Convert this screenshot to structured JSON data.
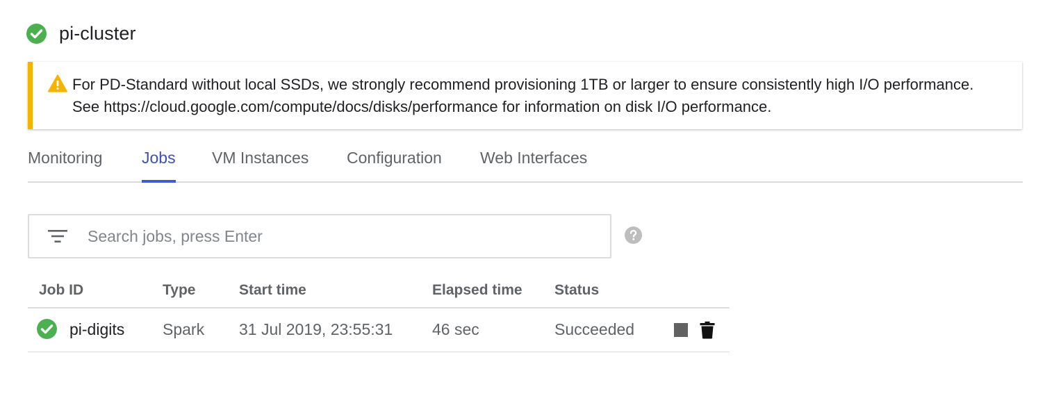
{
  "cluster": {
    "name": "pi-cluster",
    "status_icon": "check-circle-icon",
    "status_color": "#4caf50"
  },
  "banner": {
    "icon": "warning-icon",
    "accent_color": "#f4b400",
    "text": "For PD-Standard without local SSDs, we strongly recommend provisioning 1TB or larger to ensure consistently high I/O performance. See https://cloud.google.com/compute/docs/disks/performance for information on disk I/O performance."
  },
  "tabs": [
    {
      "label": "Monitoring",
      "active": false
    },
    {
      "label": "Jobs",
      "active": true
    },
    {
      "label": "VM Instances",
      "active": false
    },
    {
      "label": "Configuration",
      "active": false
    },
    {
      "label": "Web Interfaces",
      "active": false
    }
  ],
  "search": {
    "icon": "filter-icon",
    "placeholder": "Search jobs, press Enter",
    "value": "",
    "help_icon": "help-icon"
  },
  "table": {
    "columns": [
      "Job ID",
      "Type",
      "Start time",
      "Elapsed time",
      "Status"
    ],
    "rows": [
      {
        "status_icon": "check-circle-icon",
        "job_id": "pi-digits",
        "type": "Spark",
        "start_time": "31 Jul 2019, 23:55:31",
        "elapsed": "46 sec",
        "status": "Succeeded",
        "actions": [
          "stop-icon",
          "delete-icon"
        ]
      }
    ]
  },
  "colors": {
    "accent": "#3f5ad6",
    "success": "#4caf50",
    "warning": "#f4b400"
  }
}
